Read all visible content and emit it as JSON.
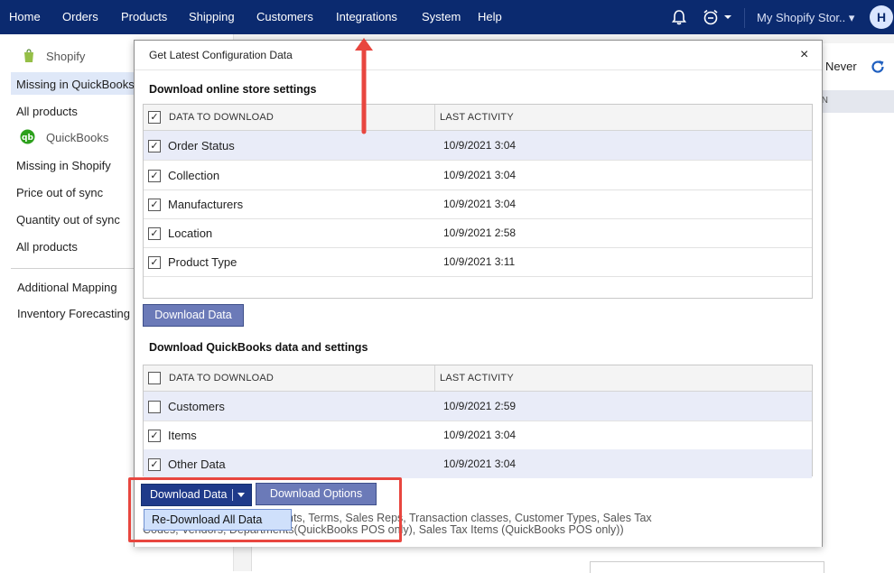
{
  "topnav": {
    "items": [
      "Home",
      "Orders",
      "Products",
      "Shipping",
      "Customers",
      "Integrations",
      "System",
      "Help"
    ],
    "store": "My Shopify Stor..",
    "avatar": "H"
  },
  "sidebar": {
    "group_shopify": "Shopify",
    "shopify_items": [
      "Missing in QuickBooks",
      "All products"
    ],
    "group_quickbooks": "QuickBooks",
    "quickbooks_items": [
      "Missing in Shopify",
      "Price out of sync",
      "Quantity out of sync",
      "All products"
    ],
    "other_items": [
      "Additional Mapping",
      "Inventory Forecasting"
    ]
  },
  "right": {
    "never": "Never",
    "header_fragment": "ON"
  },
  "dialog": {
    "title": "Get Latest Configuration Data",
    "close": "×",
    "section1": {
      "title": "Download online store settings",
      "col_data": "DATA TO DOWNLOAD",
      "col_activity": "LAST ACTIVITY",
      "rows": [
        {
          "label": "Order Status",
          "date": "10/9/2021 3:04",
          "checked": true
        },
        {
          "label": "Collection",
          "date": "10/9/2021 3:04",
          "checked": true
        },
        {
          "label": "Manufacturers",
          "date": "10/9/2021 3:04",
          "checked": true
        },
        {
          "label": "Location",
          "date": "10/9/2021 2:58",
          "checked": true
        },
        {
          "label": "Product Type",
          "date": "10/9/2021 3:11",
          "checked": true
        }
      ],
      "button": "Download Data"
    },
    "section2": {
      "title": "Download QuickBooks data and settings",
      "col_data": "DATA TO DOWNLOAD",
      "col_activity": "LAST ACTIVITY",
      "rows": [
        {
          "label": "Customers",
          "date": "10/9/2021 2:59",
          "checked": false
        },
        {
          "label": "Items",
          "date": "10/9/2021 3:04",
          "checked": true
        },
        {
          "label": "Other Data",
          "date": "10/9/2021 3:04",
          "checked": true
        }
      ]
    },
    "split_button": "Download Data",
    "options_button": "Download Options",
    "dropdown_item": "Re-Download All Data",
    "note_line1": "nts, Terms, Sales Reps, Transaction classes, Customer Types, Sales Tax",
    "note_line2": "Codes, Vendors, Departments(QuickBooks POS only), Sales Tax Items (QuickBooks POS only))"
  },
  "colors": {
    "nav_bg": "#0b2a6f",
    "button_bg": "#6b7ab8",
    "split_button_bg": "#1f3a8a",
    "highlight": "#e8463f",
    "row_alt": "#e9ecf8"
  }
}
